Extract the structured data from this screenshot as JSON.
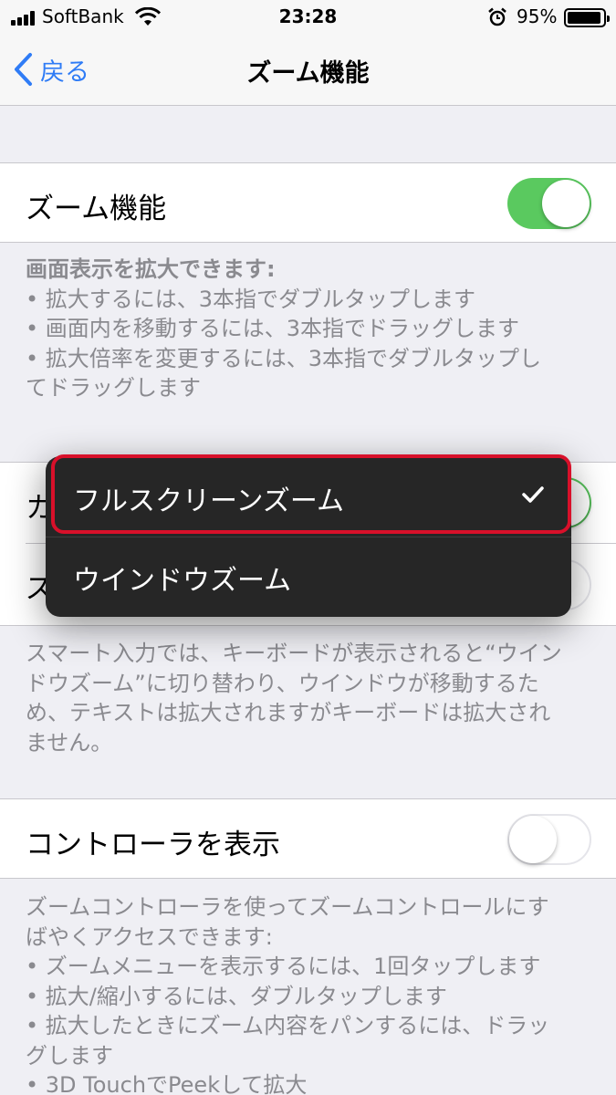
{
  "status_bar": {
    "carrier": "SoftBank",
    "time": "23:28",
    "battery": "95%",
    "battery_level": 0.95
  },
  "nav": {
    "back_label": "戻る",
    "title": "ズーム機能"
  },
  "zoom_cell": {
    "label": "ズーム機能",
    "toggle_on": true
  },
  "zoom_footer": {
    "heading": "画面表示を拡大できます:",
    "line1": "•  拡大するには、3本指でダブルタップします",
    "line2": "•  画面内を移動するには、3本指でドラッグします",
    "line3": "•  拡大倍率を変更するには、3本指でダブルタップし",
    "line4": "てドラッグします"
  },
  "hidden_cells": {
    "row1_partial": "カ",
    "row2_partial": "ズ"
  },
  "popup_menu": {
    "item1": "フルスクリーンズーム",
    "item1_selected": true,
    "item2": "ウインドウズーム"
  },
  "smart_footer": {
    "line1": "スマート入力では、キーボードが表示されると“ウイン",
    "line2": "ドウズーム”に切り替わり、ウインドウが移動するた",
    "line3": "め、テキストは拡大されますがキーボードは拡大され",
    "line4": "ません。"
  },
  "controller_cell": {
    "label": "コントローラを表示",
    "toggle_on": false
  },
  "controller_footer": {
    "line1": "ズームコントローラを使ってズームコントロールにす",
    "line2": "ばやくアクセスできます:",
    "line3": "• ズームメニューを表示するには、1回タップします",
    "line4": "• 拡大/縮小するには、ダブルタップします",
    "line5": "• 拡大したときにズーム内容をパンするには、ドラッ",
    "line6": "グします",
    "line7": "• 3D TouchでPeekして拡大"
  },
  "colors": {
    "accent": "#2f7cf6",
    "toggle_on": "#5ac95f",
    "highlight": "#d8102a",
    "menu_bg": "#262626"
  }
}
